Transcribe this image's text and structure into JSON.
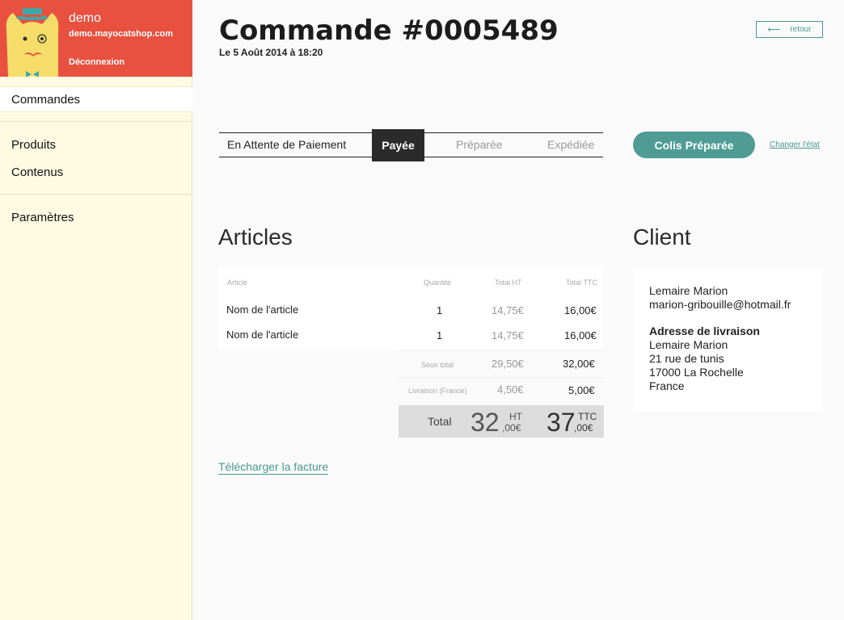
{
  "shop": {
    "name": "demo",
    "url": "demo.mayocatshop.com",
    "logout": "Déconnexion"
  },
  "nav": {
    "orders": "Commandes",
    "products": "Produits",
    "contents": "Contenus",
    "settings": "Paramètres"
  },
  "order": {
    "title": "Commande #0005489",
    "date": "Le 5 Août 2014 à 18:20",
    "back": "retour"
  },
  "statuses": {
    "awaiting": "En Attente de Paiement",
    "paid": "Payée",
    "prepared": "Préparée",
    "shipped": "Expédiée",
    "action": "Colis Préparée",
    "change": "Changer l'état"
  },
  "articles": {
    "heading": "Articles",
    "columns": {
      "article": "Article",
      "quantity": "Quantité",
      "total_ht": "Total HT",
      "total_ttc": "Total TTC"
    },
    "rows": [
      {
        "name": "Nom de l'article",
        "qty": "1",
        "ht": "14,75€",
        "ttc": "16,00€"
      },
      {
        "name": "Nom de l'article",
        "qty": "1",
        "ht": "14,75€",
        "ttc": "16,00€"
      }
    ],
    "subtotal": {
      "label": "Sous total",
      "ht": "29,50€",
      "ttc": "32,00€"
    },
    "shipping": {
      "label": "Livraison (France)",
      "ht": "4,50€",
      "ttc": "5,00€"
    },
    "total": {
      "label": "Total",
      "ht_int": "32",
      "ht_dec": ",00€",
      "ht_suffix": "HT",
      "ttc_int": "37",
      "ttc_dec": ",00€",
      "ttc_suffix": "TTC"
    },
    "invoice": "Télécharger la facture"
  },
  "client": {
    "heading": "Client",
    "name": "Lemaire Marion",
    "email": "marion-gribouille@hotmail.fr",
    "shipping_heading": "Adresse de livraison",
    "ship_name": "Lemaire Marion",
    "street": "21 rue de tunis",
    "city": "17000 La Rochelle",
    "country": "France"
  },
  "colors": {
    "header_red": "#e8503f",
    "sidebar_bg": "#fefbe2",
    "accent_teal": "#4e9c94",
    "active_dark": "#2b2b2b"
  }
}
